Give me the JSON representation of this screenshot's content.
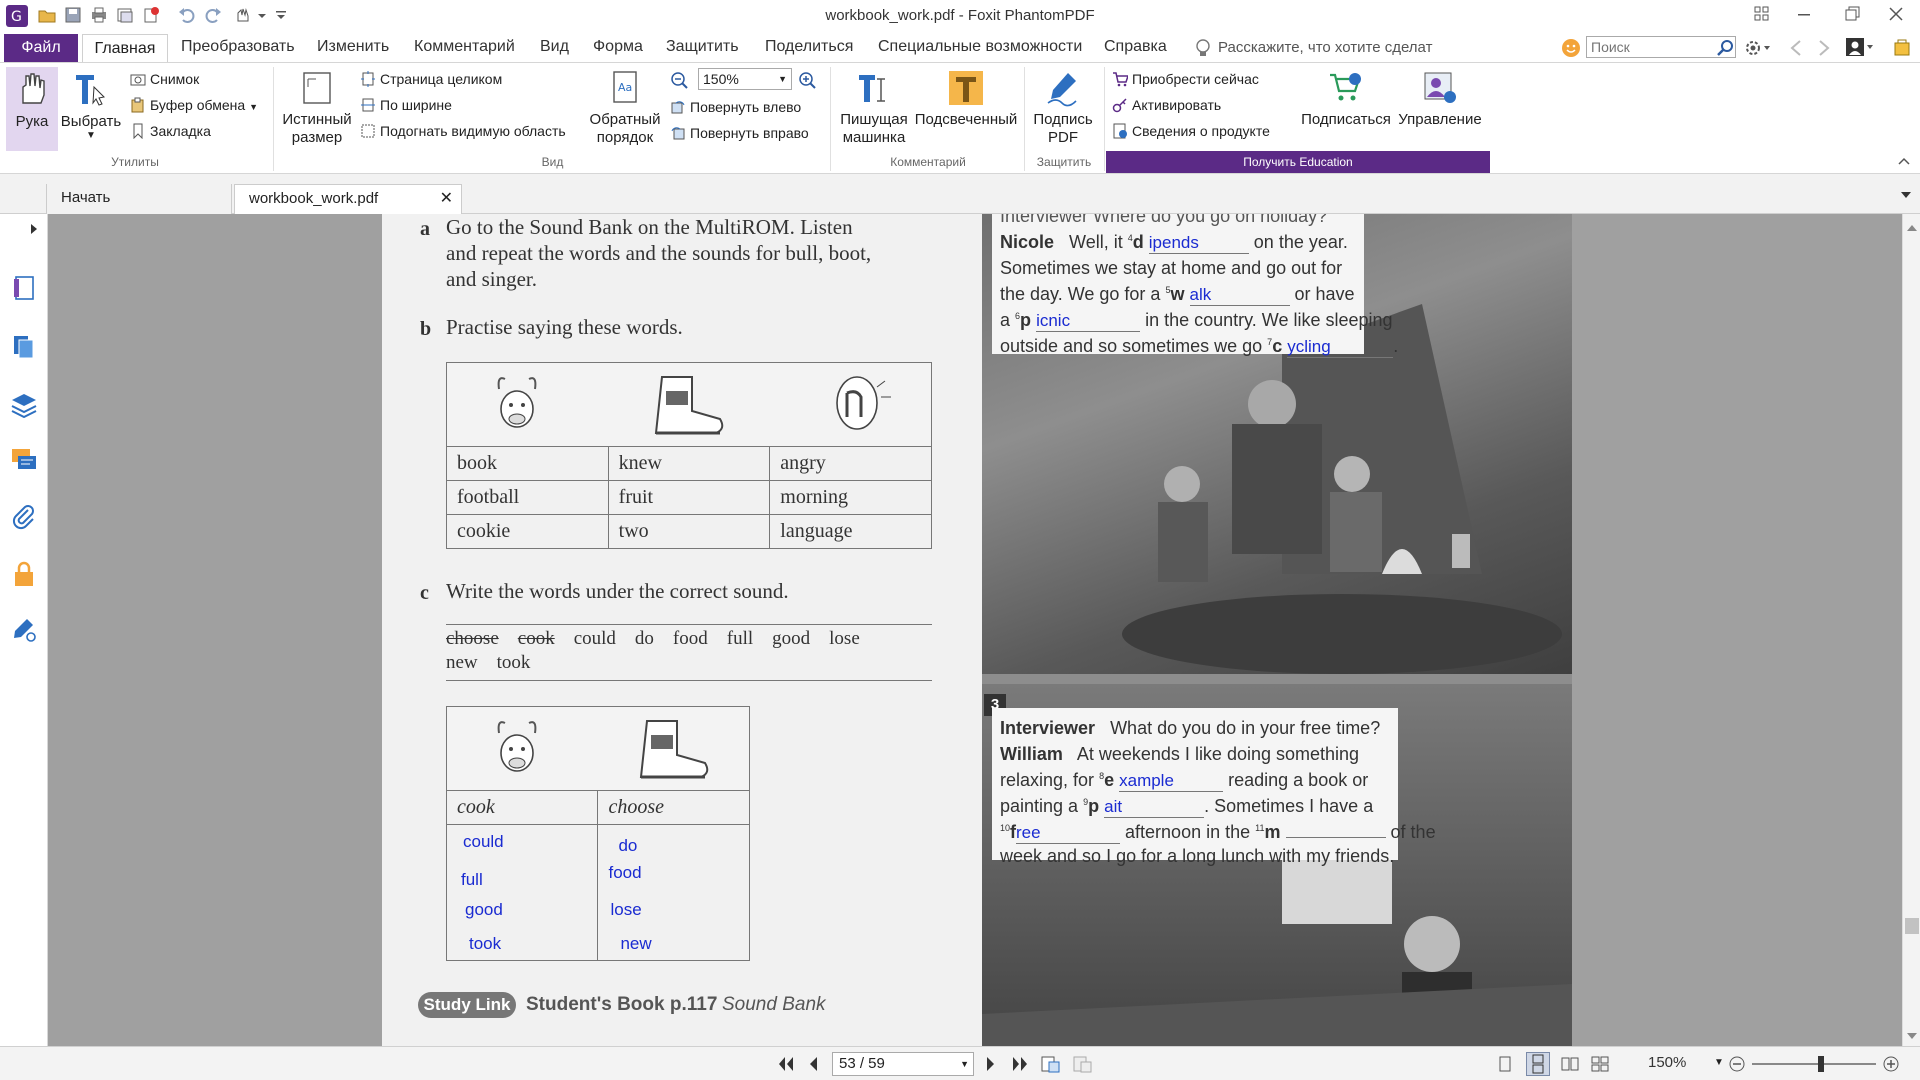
{
  "window": {
    "title": "workbook_work.pdf - Foxit PhantomPDF"
  },
  "menu": {
    "file": "Файл",
    "home": "Главная",
    "tabs": [
      "Преобразовать",
      "Изменить",
      "Комментарий",
      "Вид",
      "Форма",
      "Защитить",
      "Поделиться",
      "Специальные возможности",
      "Справка"
    ],
    "tell_me": "Расскажите, что хотите сделат",
    "search_placeholder": "Поиск"
  },
  "ribbon": {
    "hand": "Рука",
    "select": "Выбрать",
    "snapshot": "Снимок",
    "clipboard": "Буфер обмена",
    "bookmark": "Закладка",
    "utilities_label": "Утилиты",
    "actual_size_1": "Истинный",
    "actual_size_2": "размер",
    "fit_page": "Страница целиком",
    "fit_width": "По ширине",
    "fit_visible": "Подогнать видимую область",
    "reverse_1": "Обратный",
    "reverse_2": "порядок",
    "zoom_value": "150%",
    "rotate_left": "Повернуть влево",
    "rotate_right": "Повернуть вправо",
    "view_label": "Вид",
    "typewriter_1": "Пишущая",
    "typewriter_2": "машинка",
    "highlight": "Подсвеченный",
    "comment_label": "Комментарий",
    "sign_1": "Подпись",
    "sign_2": "PDF",
    "protect_label": "Защитить",
    "buy_now": "Приобрести сейчас",
    "activate": "Активировать",
    "product_info": "Сведения о продукте",
    "subscribe": "Подписаться",
    "manage": "Управление",
    "education_label": "Получить Education"
  },
  "tabs": {
    "start": "Начать",
    "doc": "workbook_work.pdf"
  },
  "workbook": {
    "a_letter": "a",
    "a_line1": "Go to the Sound Bank on the MultiROM. Listen",
    "a_line2": "and repeat the words and the sounds for bull, boot,",
    "a_line3": "and singer.",
    "b_letter": "b",
    "b_line": "Practise saying these words.",
    "table1": [
      [
        "book",
        "knew",
        "angry"
      ],
      [
        "football",
        "fruit",
        "morning"
      ],
      [
        "cookie",
        "two",
        "language"
      ]
    ],
    "c_letter": "c",
    "c_line": "Write the words under the correct sound.",
    "words_row1": [
      "choose",
      "cook",
      "could",
      "do",
      "food",
      "full",
      "good",
      "lose"
    ],
    "words_row2": [
      "new",
      "took"
    ],
    "table2_headers": [
      "cook",
      "choose"
    ],
    "table2_answers_left": [
      "could",
      "full",
      "good",
      "took"
    ],
    "table2_answers_right": [
      "do",
      "food",
      "lose",
      "new"
    ],
    "study_link": "Study Link",
    "student_book": "Student's Book p.117",
    "sound_bank": "Sound Bank"
  },
  "card1": {
    "top_partial": "Interviewer  Where do you go on holiday?",
    "nicole": "Nicole",
    "l1a": "Well, it",
    "n4": "4",
    "d": "d",
    "ans4": "ipends",
    "l1b": "on the year.",
    "l2": "Sometimes we stay at home and go out for",
    "l3a": "the day. We go for a",
    "n5": "5",
    "w": "w",
    "ans5": "alk",
    "l3b": "or have",
    "l4a": "a",
    "n6": "6",
    "p": "p",
    "ans6": "icnic",
    "l4b": "in the country. We like sleeping",
    "l5a": "outside and so sometimes we go",
    "n7": "7",
    "c": "c",
    "ans7": "ycling",
    "l5b": "."
  },
  "card2": {
    "num": "3",
    "interviewer": "Interviewer",
    "q": "What do you do in your free time?",
    "william": "William",
    "l1": "At weekends I like doing something",
    "l2a": "relaxing, for",
    "n8": "8",
    "e": "e",
    "ans8": "xample",
    "l2b": "reading a book or",
    "l3a": "painting a",
    "n9": "9",
    "p": "p",
    "ans9": "ait",
    "l3b": ". Sometimes I have a",
    "n10": "10",
    "f": "f",
    "ans10": "ree",
    "l4a": "afternoon in the",
    "n11": "11",
    "m": "m",
    "l4b": "of the",
    "l5": "week and so I go for a long lunch with my friends."
  },
  "status": {
    "page": "53 / 59",
    "zoom": "150%"
  },
  "colors": {
    "brand": "#5b2a86",
    "answer": "#1a2bd1"
  }
}
